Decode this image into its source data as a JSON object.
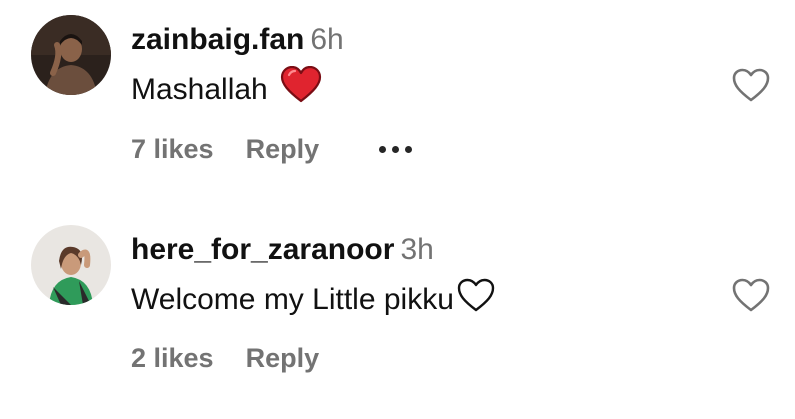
{
  "comments": [
    {
      "username": "zainbaig.fan",
      "time": "6h",
      "text": "Mashallah",
      "text_emoji": "red-heart",
      "likes": "7 likes",
      "reply": "Reply",
      "has_more_menu": true
    },
    {
      "username": "here_for_zaranoor",
      "time": "3h",
      "text": "Welcome my Little pikku",
      "text_emoji": "white-heart",
      "likes": "2 likes",
      "reply": "Reply",
      "has_more_menu": false
    }
  ],
  "colors": {
    "secondary_text": "#737373",
    "primary_text": "#111111",
    "heart_red": "#e0242f"
  },
  "icons": {
    "like": "heart-outline-icon",
    "more": "more-options-icon"
  }
}
